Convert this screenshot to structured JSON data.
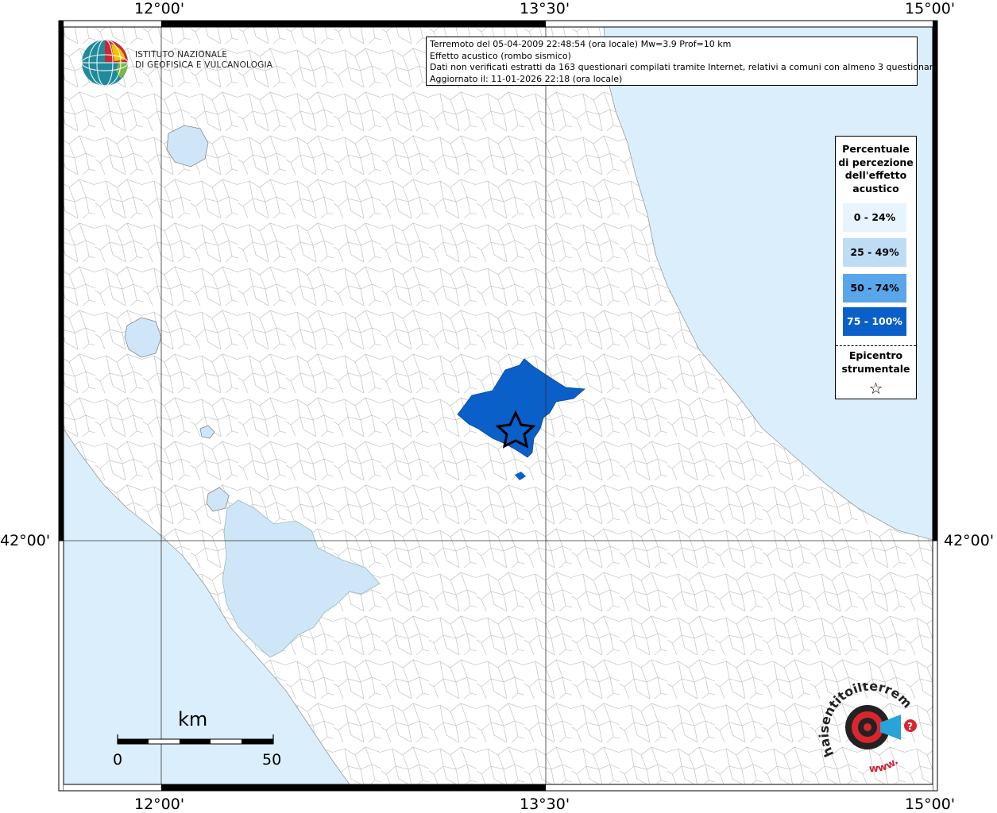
{
  "org": {
    "line1": "ISTITUTO NAZIONALE",
    "line2": "DI GEOFISICA E VULCANOLOGIA"
  },
  "info": {
    "line1": "Terremoto del 05-04-2009 22:48:54 (ora locale) Mw=3.9 Prof=10 km",
    "line2": "Effetto acustico (rombo sismico)",
    "line3": "Dati non verificati estratti da 163 questionari compilati tramite Internet, relativi a comuni con almeno 3 questionari.",
    "line4": "Aggiornato il: 11-01-2026 22:18 (ora locale)"
  },
  "axes": {
    "top": [
      "12°00'",
      "13°30'",
      "15°00'"
    ],
    "bottom": [
      "12°00'",
      "13°30'",
      "15°00'"
    ],
    "left": "42°00'",
    "right": "42°00'"
  },
  "legend": {
    "title": [
      "Percentuale",
      "di percezione",
      "dell'effetto",
      "acustico"
    ],
    "classes": [
      {
        "label": "0 - 24%",
        "color": "#e8f4fd",
        "text": "#000000"
      },
      {
        "label": "25 - 49%",
        "color": "#bfdcf5",
        "text": "#000000"
      },
      {
        "label": "50 - 74%",
        "color": "#5aa6ea",
        "text": "#000000"
      },
      {
        "label": "75 - 100%",
        "color": "#0a5fc8",
        "text": "#ffffff"
      }
    ],
    "epicenter": [
      "Epicentro",
      "strumentale"
    ],
    "star_symbol": "☆"
  },
  "scale": {
    "unit": "km",
    "min": "0",
    "max": "50"
  },
  "hst_logo": {
    "text_top": "haisentitoilterremoto.it",
    "text_bottom": "www.",
    "icon": "megaphone-target-icon"
  },
  "colors": {
    "sea": "#dbeefb",
    "lake": "#cfe6f8",
    "affected_area": "#0a5fc8",
    "land": "#ffffff",
    "boundary": "#c8c8c8"
  }
}
